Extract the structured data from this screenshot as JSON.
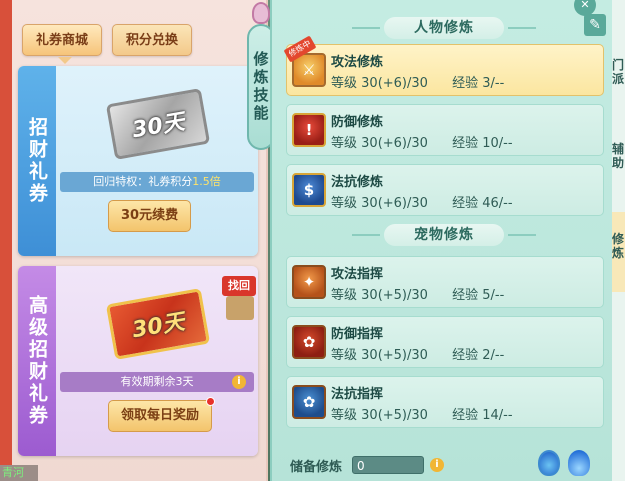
{
  "left_panel": {
    "tabs": [
      {
        "label": "礼券商城"
      },
      {
        "label": "积分兑换"
      }
    ],
    "card1": {
      "side_title": "招财礼券",
      "ticket_text": "30天",
      "privilege_prefix": "回归特权：礼券积分",
      "privilege_value": "1.5倍",
      "button": "30元续费"
    },
    "card2": {
      "side_title": "高级招财礼券",
      "ticket_text": "30天",
      "retrieve_label": "找回",
      "validity": "有效期剩余3天",
      "button": "领取每日奖励"
    },
    "bottom_label": "青河"
  },
  "vertical_tag": "修炼技能",
  "right_panel": {
    "section_character": "人物修炼",
    "section_pet": "宠物修炼",
    "ribbon": "修炼中",
    "character_skills": [
      {
        "name": "攻法修炼",
        "level_label": "等级",
        "level": "30(+6)/30",
        "exp_label": "经验",
        "exp": "3/--"
      },
      {
        "name": "防御修炼",
        "level_label": "等级",
        "level": "30(+6)/30",
        "exp_label": "经验",
        "exp": "10/--"
      },
      {
        "name": "法抗修炼",
        "level_label": "等级",
        "level": "30(+6)/30",
        "exp_label": "经验",
        "exp": "46/--"
      }
    ],
    "pet_skills": [
      {
        "name": "攻法指挥",
        "level_label": "等级",
        "level": "30(+5)/30",
        "exp_label": "经验",
        "exp": "5/--"
      },
      {
        "name": "防御指挥",
        "level_label": "等级",
        "level": "30(+5)/30",
        "exp_label": "经验",
        "exp": "2/--"
      },
      {
        "name": "法抗指挥",
        "level_label": "等级",
        "level": "30(+5)/30",
        "exp_label": "经验",
        "exp": "14/--"
      }
    ],
    "reserve_label": "储备修炼",
    "reserve_value": "0"
  },
  "edge_text": {
    "top": "门派",
    "middle": "辅助",
    "bottom": "修炼"
  },
  "colors": {
    "accent_red": "#d8503a",
    "panel_teal": "#c4ece2",
    "blue_card": "#3e8fd6",
    "purple_card": "#9c5bd0",
    "highlight": "#fbe6a0"
  },
  "icons": {
    "edit": "edit-icon",
    "info": "info-icon",
    "potion": "potion-icon",
    "flame": "flame-icon"
  }
}
